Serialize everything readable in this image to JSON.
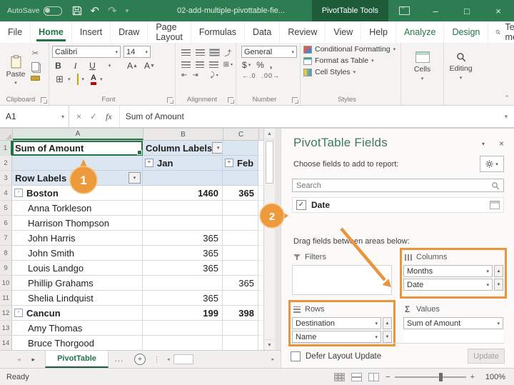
{
  "window": {
    "autosave_label": "AutoSave",
    "title": "02-add-multiple-pivottable-fie...",
    "context_tab": "PivotTable Tools"
  },
  "ribbon_tabs": [
    {
      "label": "File"
    },
    {
      "label": "Home",
      "active": true
    },
    {
      "label": "Insert"
    },
    {
      "label": "Draw"
    },
    {
      "label": "Page Layout"
    },
    {
      "label": "Formulas"
    },
    {
      "label": "Data"
    },
    {
      "label": "Review"
    },
    {
      "label": "View"
    },
    {
      "label": "Help"
    },
    {
      "label": "Analyze",
      "contextual": true
    },
    {
      "label": "Design",
      "contextual": true
    }
  ],
  "tellme_label": "Tell me",
  "ribbon": {
    "paste_label": "Paste",
    "font_name": "Calibri",
    "font_size": "14",
    "number_format": "General",
    "styles": [
      "Conditional Formatting",
      "Format as Table",
      "Cell Styles"
    ],
    "cells_label": "Cells",
    "editing_label": "Editing",
    "groups": [
      "Clipboard",
      "Font",
      "Alignment",
      "Number",
      "Styles"
    ]
  },
  "formula_bar": {
    "name_box": "A1",
    "fx": "fx",
    "content": "Sum of Amount"
  },
  "grid": {
    "col_headers": [
      "A",
      "B",
      "C"
    ],
    "rows": [
      {
        "n": 1,
        "blue": true,
        "a": {
          "t": "Sum of Amount",
          "bold": true,
          "sel": true
        },
        "b": {
          "t": "Column Labels",
          "bold": true,
          "dd": true
        },
        "c": {}
      },
      {
        "n": 2,
        "blue": true,
        "a": {},
        "b": {
          "t": "Jan",
          "bold": true,
          "exp": "+"
        },
        "c": {
          "t": "Feb",
          "bold": true,
          "exp": "+"
        }
      },
      {
        "n": 3,
        "blue": true,
        "a": {
          "t": "Row Labels",
          "bold": true,
          "dd": true
        },
        "b": {},
        "c": {}
      },
      {
        "n": 4,
        "a": {
          "t": "Boston",
          "bold": true,
          "exp": "-"
        },
        "b": {
          "t": "1460",
          "bold": true,
          "right": true
        },
        "c": {
          "t": "365",
          "bold": true,
          "right": true
        }
      },
      {
        "n": 5,
        "a": {
          "t": "Anna Torkleson",
          "ind": true
        },
        "b": {},
        "c": {}
      },
      {
        "n": 6,
        "a": {
          "t": "Harrison Thompson",
          "ind": true
        },
        "b": {},
        "c": {}
      },
      {
        "n": 7,
        "a": {
          "t": "John Harris",
          "ind": true
        },
        "b": {
          "t": "365",
          "right": true
        },
        "c": {}
      },
      {
        "n": 8,
        "a": {
          "t": "John Smith",
          "ind": true
        },
        "b": {
          "t": "365",
          "right": true
        },
        "c": {}
      },
      {
        "n": 9,
        "a": {
          "t": "Louis Landgo",
          "ind": true
        },
        "b": {
          "t": "365",
          "right": true
        },
        "c": {}
      },
      {
        "n": 10,
        "a": {
          "t": "Phillip Grahams",
          "ind": true
        },
        "b": {},
        "c": {
          "t": "365",
          "right": true
        }
      },
      {
        "n": 11,
        "a": {
          "t": "Shelia Lindquist",
          "ind": true
        },
        "b": {
          "t": "365",
          "right": true
        },
        "c": {}
      },
      {
        "n": 12,
        "a": {
          "t": "Cancun",
          "bold": true,
          "exp": "-"
        },
        "b": {
          "t": "199",
          "bold": true,
          "right": true
        },
        "c": {
          "t": "398",
          "bold": true,
          "right": true
        }
      },
      {
        "n": 13,
        "a": {
          "t": "Amy Thomas",
          "ind": true
        },
        "b": {},
        "c": {}
      },
      {
        "n": 14,
        "a": {
          "t": "Bruce Thorgood",
          "ind": true
        },
        "b": {},
        "c": {}
      }
    ]
  },
  "sheet": {
    "tab_label": "PivotTable"
  },
  "status": {
    "ready": "Ready",
    "zoom": "100%"
  },
  "pane": {
    "title": "PivotTable Fields",
    "subtitle": "Choose fields to add to report:",
    "search_placeholder": "Search",
    "fields": [
      {
        "label": "Date",
        "checked": true
      }
    ],
    "drag_hint": "Drag fields between areas below:",
    "areas": {
      "filters": {
        "label": "Filters",
        "items": []
      },
      "columns": {
        "label": "Columns",
        "items": [
          "Months",
          "Date"
        ],
        "highlighted": true
      },
      "rows": {
        "label": "Rows",
        "items": [
          "Destination",
          "Name"
        ],
        "highlighted": true
      },
      "values": {
        "label": "Values",
        "items": [
          "Sum of Amount"
        ]
      }
    },
    "defer_label": "Defer Layout Update",
    "update_label": "Update"
  },
  "callouts": {
    "one": "1",
    "two": "2"
  },
  "icons": {
    "undo": "↶",
    "redo": "↷",
    "minimize": "–",
    "maximize": "□",
    "close": "×",
    "dropdown": "▾",
    "check": "✓",
    "cut": "✂",
    "up": "▲",
    "down": "▼",
    "left": "◂",
    "right": "▸",
    "sigma": "Σ",
    "plus": "+"
  },
  "colors": {
    "title_green": "#2e7d52",
    "dark_green": "#1e5b38",
    "accent_green": "#217346",
    "callout_orange": "#e8953e",
    "pivot_header_blue": "#dce6f1"
  }
}
